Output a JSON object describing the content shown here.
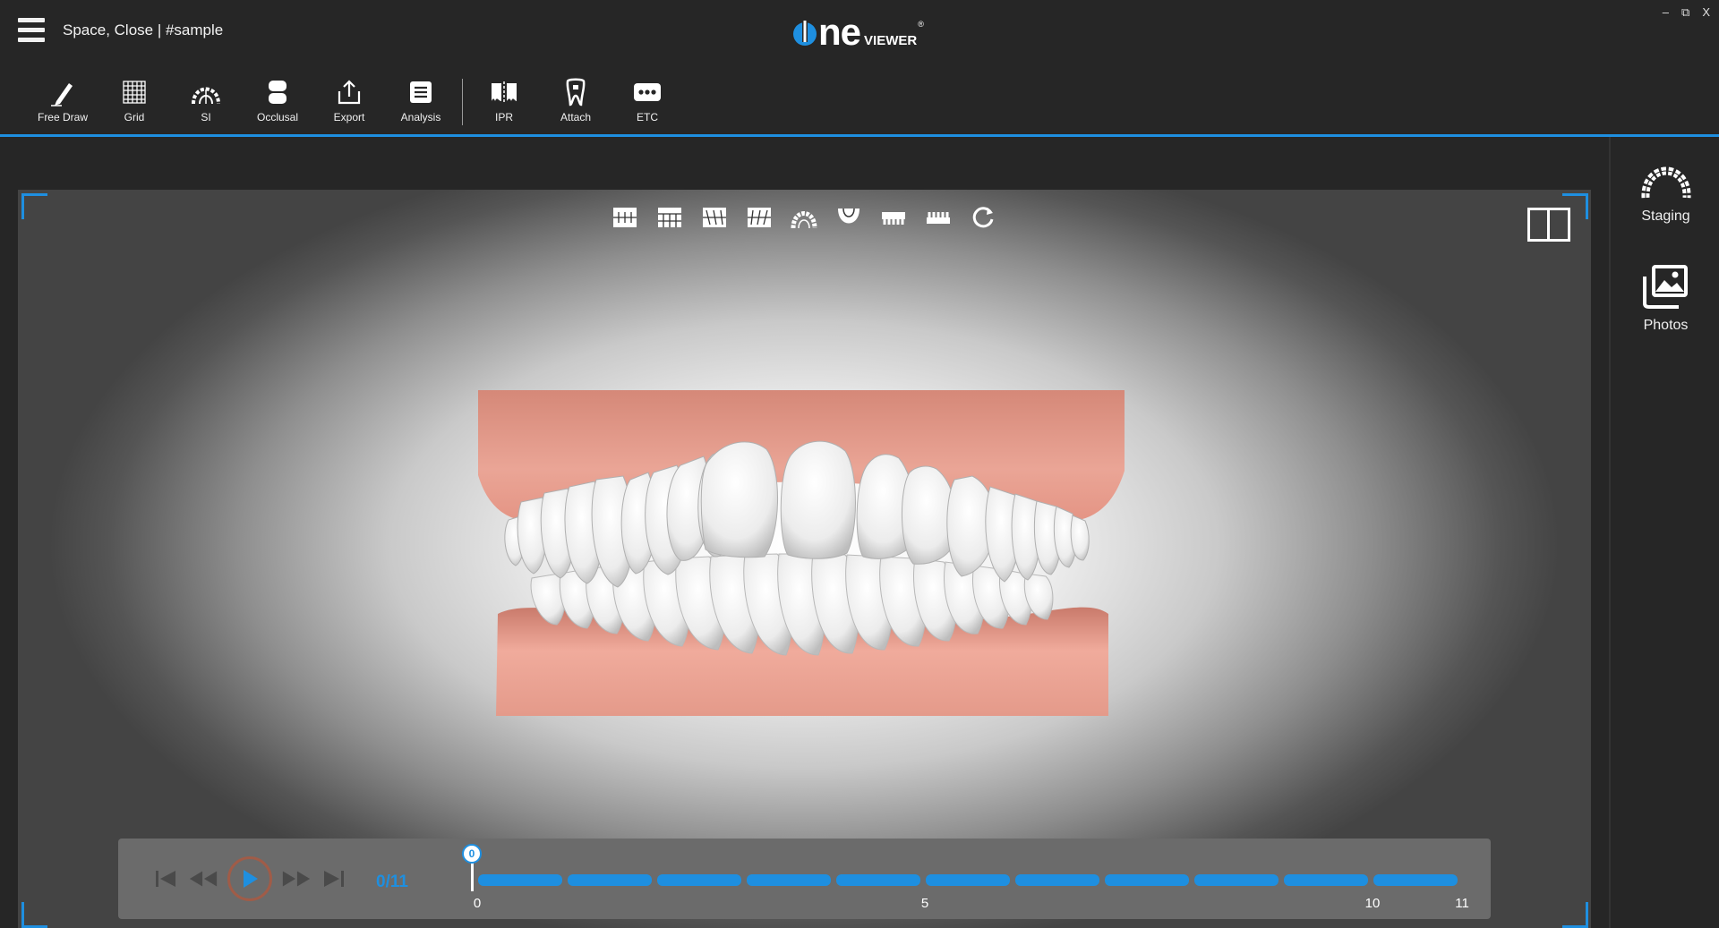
{
  "window": {
    "doc_title": "Space, Close | #sample",
    "logo_one": "ne",
    "logo_viewer": "VIEWER",
    "logo_reg": "®",
    "controls": {
      "minimize": "–",
      "restore": "⧉",
      "close": "X"
    }
  },
  "toolbar": {
    "tools": [
      {
        "label": "Free Draw",
        "icon": "pencil-icon"
      },
      {
        "label": "Grid",
        "icon": "grid-icon"
      },
      {
        "label": "SI",
        "icon": "arch-icon"
      },
      {
        "label": "Occlusal",
        "icon": "occlusal-icon"
      },
      {
        "label": "Export",
        "icon": "export-icon"
      },
      {
        "label": "Analysis",
        "icon": "analysis-icon"
      },
      {
        "label": "IPR",
        "icon": "ipr-icon"
      },
      {
        "label": "Attach",
        "icon": "tooth-attach-icon"
      },
      {
        "label": "ETC",
        "icon": "more-icon"
      }
    ]
  },
  "right_panel": {
    "items": [
      {
        "label": "Staging",
        "icon": "staging-arch-icon"
      },
      {
        "label": "Photos",
        "icon": "photos-icon"
      }
    ]
  },
  "view_toolbar": {
    "icons": [
      "front-view-icon",
      "upper-front-view-icon",
      "right-view-icon",
      "left-view-icon",
      "upper-occlusal-icon",
      "lower-occlusal-icon",
      "upper-arch-icon",
      "lower-arch-icon",
      "reset-rotation-icon"
    ]
  },
  "playback": {
    "counter": "0/11",
    "current_step": 0,
    "total_steps": 11,
    "marker_label": "0",
    "tick_labels": [
      "0",
      "5",
      "10",
      "11"
    ]
  },
  "colors": {
    "accent": "#1e8fe0",
    "background": "#262626",
    "gum": "#e49a8a",
    "tooth": "#f2f2f2"
  }
}
